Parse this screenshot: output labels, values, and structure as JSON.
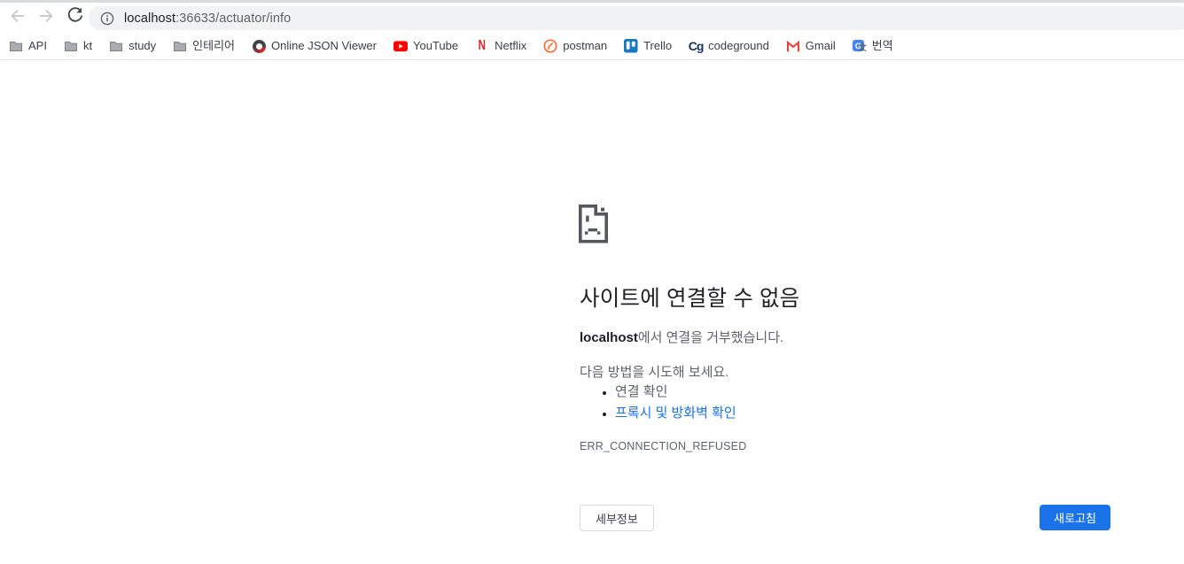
{
  "browser": {
    "url": {
      "host": "localhost",
      "path": ":36633/actuator/info"
    }
  },
  "bookmarks_bar": {
    "items": [
      {
        "label": "API",
        "icon": "folder-icon"
      },
      {
        "label": "kt",
        "icon": "folder-icon"
      },
      {
        "label": "study",
        "icon": "folder-icon"
      },
      {
        "label": "인테리어",
        "icon": "folder-icon"
      },
      {
        "label": "Online JSON Viewer",
        "icon": "json-viewer-icon"
      },
      {
        "label": "YouTube",
        "icon": "youtube-icon"
      },
      {
        "label": "Netflix",
        "icon": "netflix-icon"
      },
      {
        "label": "postman",
        "icon": "postman-icon"
      },
      {
        "label": "Trello",
        "icon": "trello-icon"
      },
      {
        "label": "codeground",
        "icon": "codeground-icon"
      },
      {
        "label": "Gmail",
        "icon": "gmail-icon"
      },
      {
        "label": "번역",
        "icon": "translate-icon"
      }
    ]
  },
  "error_page": {
    "title": "사이트에 연결할 수 없음",
    "message": {
      "host": "localhost",
      "rest": "에서 연결을 거부했습니다."
    },
    "suggestions_intro": "다음 방법을 시도해 보세요.",
    "suggestions": [
      {
        "label": "연결 확인",
        "is_link": false
      },
      {
        "label": "프록시 및 방화벽 확인",
        "is_link": true
      }
    ],
    "error_code": "ERR_CONNECTION_REFUSED",
    "buttons": {
      "details": "세부정보",
      "reload": "새로고침"
    }
  },
  "colors": {
    "accent_blue": "#1a73e8",
    "link_blue": "#1a73e8",
    "text_dark": "#202124",
    "text_gray": "#5f6368",
    "omnibox_bg": "#f0f2f4",
    "youtube_red": "#ff0000",
    "netflix_red": "#d81f26",
    "postman_orange": "#ff6c37",
    "trello_blue": "#1779be",
    "gmail_red": "#ea4335"
  }
}
